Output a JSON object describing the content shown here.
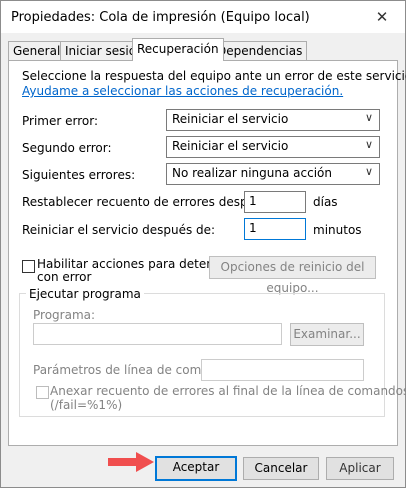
{
  "window": {
    "title": "Propiedades: Cola de impresión (Equipo local)",
    "close": "✕"
  },
  "tabs": [
    "General",
    "Iniciar sesión",
    "Recuperación",
    "Dependencias"
  ],
  "recovery": {
    "intro": "Seleccione la respuesta del equipo ante un error de este servicio.",
    "help_link": "Ayudame a seleccionar las acciones de recuperación.",
    "first_failure_label": "Primer error:",
    "first_failure_value": "Reiniciar el servicio",
    "second_failure_label": "Segundo error:",
    "second_failure_value": "Reiniciar el servicio",
    "subsequent_failures_label": "Siguientes errores:",
    "subsequent_failures_value": "No realizar ninguna acción",
    "reset_count_label": "Restablecer recuento de errores después de:",
    "reset_count_value": "1",
    "reset_count_unit": "días",
    "restart_service_label": "Reiniciar el servicio después de:",
    "restart_service_value": "1",
    "restart_service_unit": "minutos",
    "enable_actions_line1": "Habilitar acciones para detenciones",
    "enable_actions_line2": "con error",
    "restart_options_button": "Opciones de reinicio del equipo..."
  },
  "run_program": {
    "legend": "Ejecutar programa",
    "program_label": "Programa:",
    "program_value": "",
    "browse_button": "Examinar...",
    "params_label": "Parámetros de línea de comandos:",
    "params_value": "",
    "append_line1": "Anexar recuento de errores al final de la línea de comandos",
    "append_line2": "(/fail=%1%)"
  },
  "footer": {
    "ok": "Aceptar",
    "cancel": "Cancelar",
    "apply": "Aplicar"
  }
}
